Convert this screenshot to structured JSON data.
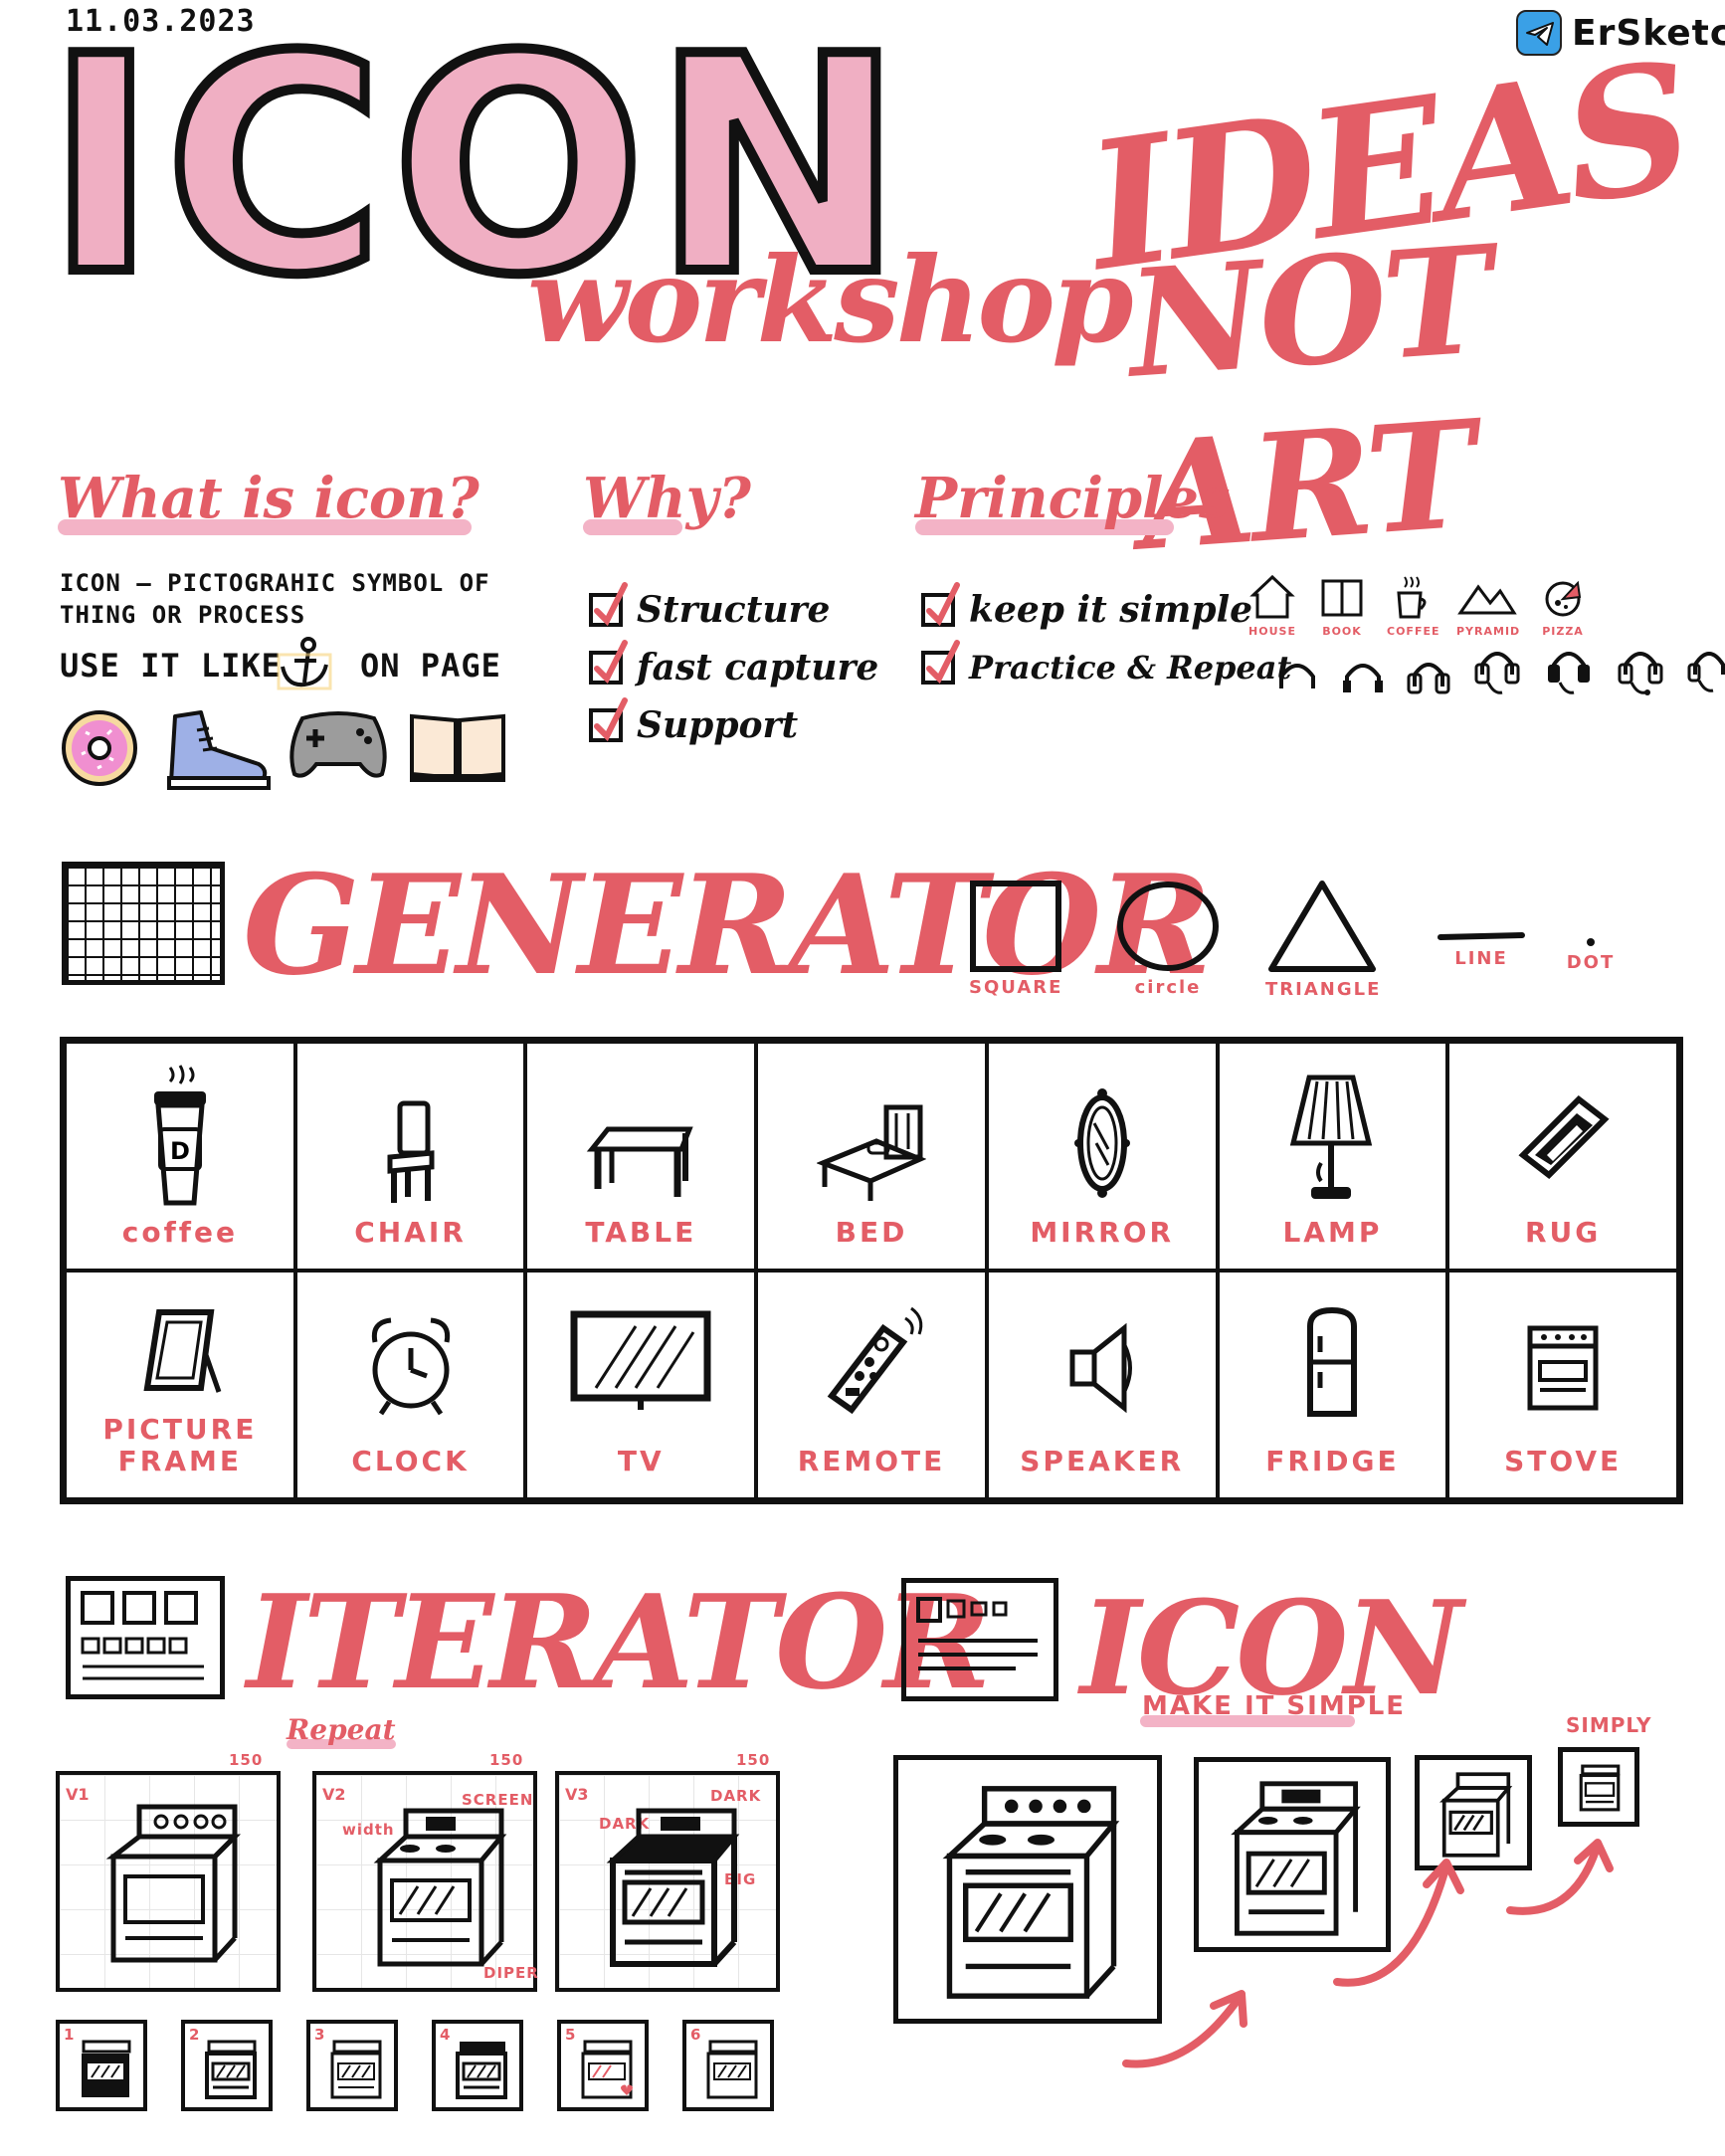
{
  "header": {
    "date": "11.03.2023",
    "brand": "ErSketch",
    "big_title": "ICON",
    "subtitle": "workshop",
    "slogan_line1": "IDEAS",
    "slogan_line2": "NOT ART"
  },
  "what": {
    "heading": "What is icon?",
    "definition_line1": "ICON – PICTOGRAHIC SYMBOL OF",
    "definition_line2": "THING OR PROCESS",
    "use_prefix": "USE IT LIKE",
    "use_suffix": "ON PAGE"
  },
  "why": {
    "heading": "Why?",
    "items": [
      "Structure",
      "fast capture",
      "Support"
    ]
  },
  "principles": {
    "heading": "Principles",
    "items": [
      "keep it simple",
      "Practice & Repeat"
    ],
    "mini_labels": [
      "HOUSE",
      "BOOK",
      "COFFEE",
      "PYRAMID",
      "PIZZA"
    ]
  },
  "generator": {
    "heading": "GENERATOR",
    "shapes": [
      "SQUARE",
      "circle",
      "TRIANGLE",
      "LINE",
      "DOT"
    ],
    "cells": [
      "coffee",
      "CHAIR",
      "TABLE",
      "BED",
      "MIRROR",
      "LAMP",
      "RUG",
      "PICTURE\nFRAME",
      "CLOCK",
      "TV",
      "REMOTE",
      "SPEAKER",
      "FRIDGE",
      "STOVE"
    ]
  },
  "iterator": {
    "heading": "ITERATOR",
    "sub": "Repeat",
    "versions": [
      "V1",
      "V2",
      "V3"
    ],
    "size": "150",
    "notes": [
      "width",
      "SCREEN",
      "DIPER",
      "DARK",
      "DARK",
      "BIG"
    ],
    "thumbs": [
      "1",
      "2",
      "3",
      "4",
      "5",
      "6"
    ]
  },
  "icon_section": {
    "heading": "ICON",
    "sub": "MAKE IT SIMPLE",
    "note": "SIMPLY"
  },
  "colors": {
    "accent": "#e35d66",
    "pink": "#f0afc3",
    "ink": "#111111"
  }
}
